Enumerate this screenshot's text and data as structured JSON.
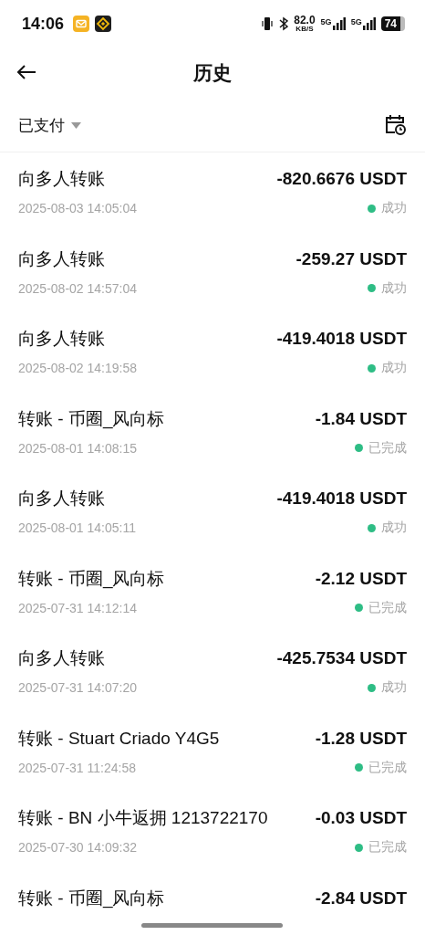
{
  "status_bar": {
    "time": "14:06",
    "speed": "82.0",
    "speed_unit": "KB/S",
    "network_1": "5G",
    "network_2": "5G",
    "battery": "74"
  },
  "header": {
    "title": "历史"
  },
  "filter": {
    "label": "已支付"
  },
  "transactions": [
    {
      "title": "向多人转账",
      "date": "2025-08-03 14:05:04",
      "amount": "-820.6676 USDT",
      "status": "成功"
    },
    {
      "title": "向多人转账",
      "date": "2025-08-02 14:57:04",
      "amount": "-259.27 USDT",
      "status": "成功"
    },
    {
      "title": "向多人转账",
      "date": "2025-08-02 14:19:58",
      "amount": "-419.4018 USDT",
      "status": "成功"
    },
    {
      "title": "转账 - 币圈_风向标",
      "date": "2025-08-01 14:08:15",
      "amount": "-1.84 USDT",
      "status": "已完成"
    },
    {
      "title": "向多人转账",
      "date": "2025-08-01 14:05:11",
      "amount": "-419.4018 USDT",
      "status": "成功"
    },
    {
      "title": "转账 - 币圈_风向标",
      "date": "2025-07-31 14:12:14",
      "amount": "-2.12 USDT",
      "status": "已完成"
    },
    {
      "title": "向多人转账",
      "date": "2025-07-31 14:07:20",
      "amount": "-425.7534 USDT",
      "status": "成功"
    },
    {
      "title": "转账 - Stuart Criado Y4G5",
      "date": "2025-07-31 11:24:58",
      "amount": "-1.28 USDT",
      "status": "已完成"
    },
    {
      "title": "转账 - BN 小牛返拥 1213722170",
      "date": "2025-07-30 14:09:32",
      "amount": "-0.03 USDT",
      "status": "已完成"
    },
    {
      "title": "转账 - 币圈_风向标",
      "amount": "-2.84 USDT"
    }
  ]
}
